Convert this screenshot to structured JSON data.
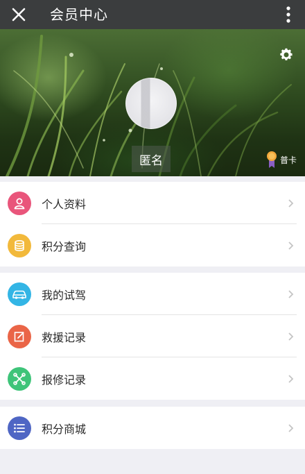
{
  "topbar": {
    "title": "会员中心",
    "close_icon": "close-icon",
    "more_icon": "more-vertical-icon",
    "background": "#3b3d3e"
  },
  "profile": {
    "name": "匿名",
    "card_level": "普卡",
    "settings_icon": "gear-icon",
    "badge_icon": "medal-icon"
  },
  "menu": {
    "group1": [
      {
        "label": "个人资料",
        "icon": "person-icon",
        "color": "#e9557b"
      },
      {
        "label": "积分查询",
        "icon": "coins-icon",
        "color": "#f2b93b"
      }
    ],
    "group2": [
      {
        "label": "我的试驾",
        "icon": "car-icon",
        "color": "#33b5e5"
      },
      {
        "label": "救援记录",
        "icon": "edit-icon",
        "color": "#ea6547"
      },
      {
        "label": "报修记录",
        "icon": "wrench-icon",
        "color": "#3ec479"
      }
    ],
    "group3": [
      {
        "label": "积分商城",
        "icon": "list-icon",
        "color": "#4f66c4"
      }
    ],
    "chevron_icon": "chevron-right-icon"
  }
}
